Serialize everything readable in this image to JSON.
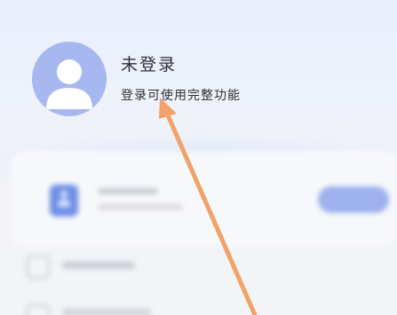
{
  "profile": {
    "name": "未登录",
    "subtitle": "登录可使用完整功能"
  },
  "colors": {
    "avatar_bg": "#a6b8ef",
    "accent": "#6f8fe6",
    "annotation_arrow": "#f2a168"
  },
  "icons": {
    "avatar": "user-silhouette",
    "card": "person-badge",
    "annotation": "arrow-pointer"
  }
}
